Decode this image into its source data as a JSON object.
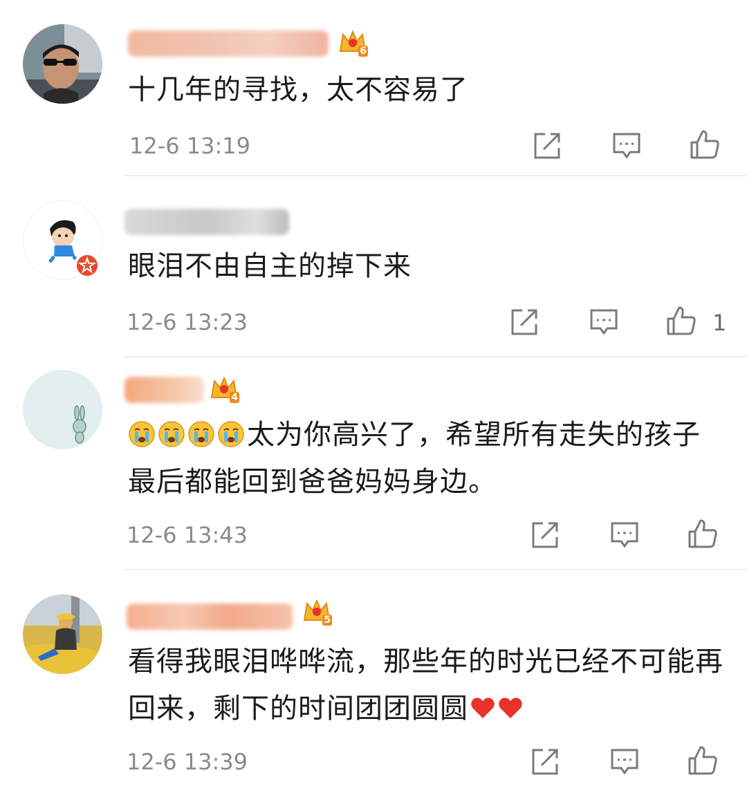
{
  "comments": [
    {
      "text": "十几年的寻找，太不容易了",
      "time": "12-6 13:19",
      "level": "6",
      "like_count": ""
    },
    {
      "text": "眼泪不由自主的掉下来",
      "time": "12-6 13:23",
      "level": "",
      "like_count": "1"
    },
    {
      "text": "太为你高兴了，希望所有走失的孩子最后都能回到爸爸妈妈身边。",
      "time": "12-6 13:43",
      "level": "4",
      "like_count": ""
    },
    {
      "text": "看得我眼泪哗哗流，那些年的时光已经不可能再回来，剩下的时间团团圆圆",
      "time": "12-6 13:39",
      "level": "5",
      "like_count": ""
    }
  ],
  "icons": {
    "share": "share-icon",
    "reply": "comment-icon",
    "like": "thumbs-up-icon",
    "crying_emoji": "crying-emoji-icon",
    "heart": "red-heart-icon",
    "crown": "vip-crown-icon",
    "verified": "verified-badge-icon"
  },
  "colors": {
    "text": "#1a1a1a",
    "timestamp": "#8a8a8a",
    "icon": "#7a7a7a",
    "heart": "#e8332a",
    "badge": "#e8492f",
    "divider": "#eeeeee"
  }
}
